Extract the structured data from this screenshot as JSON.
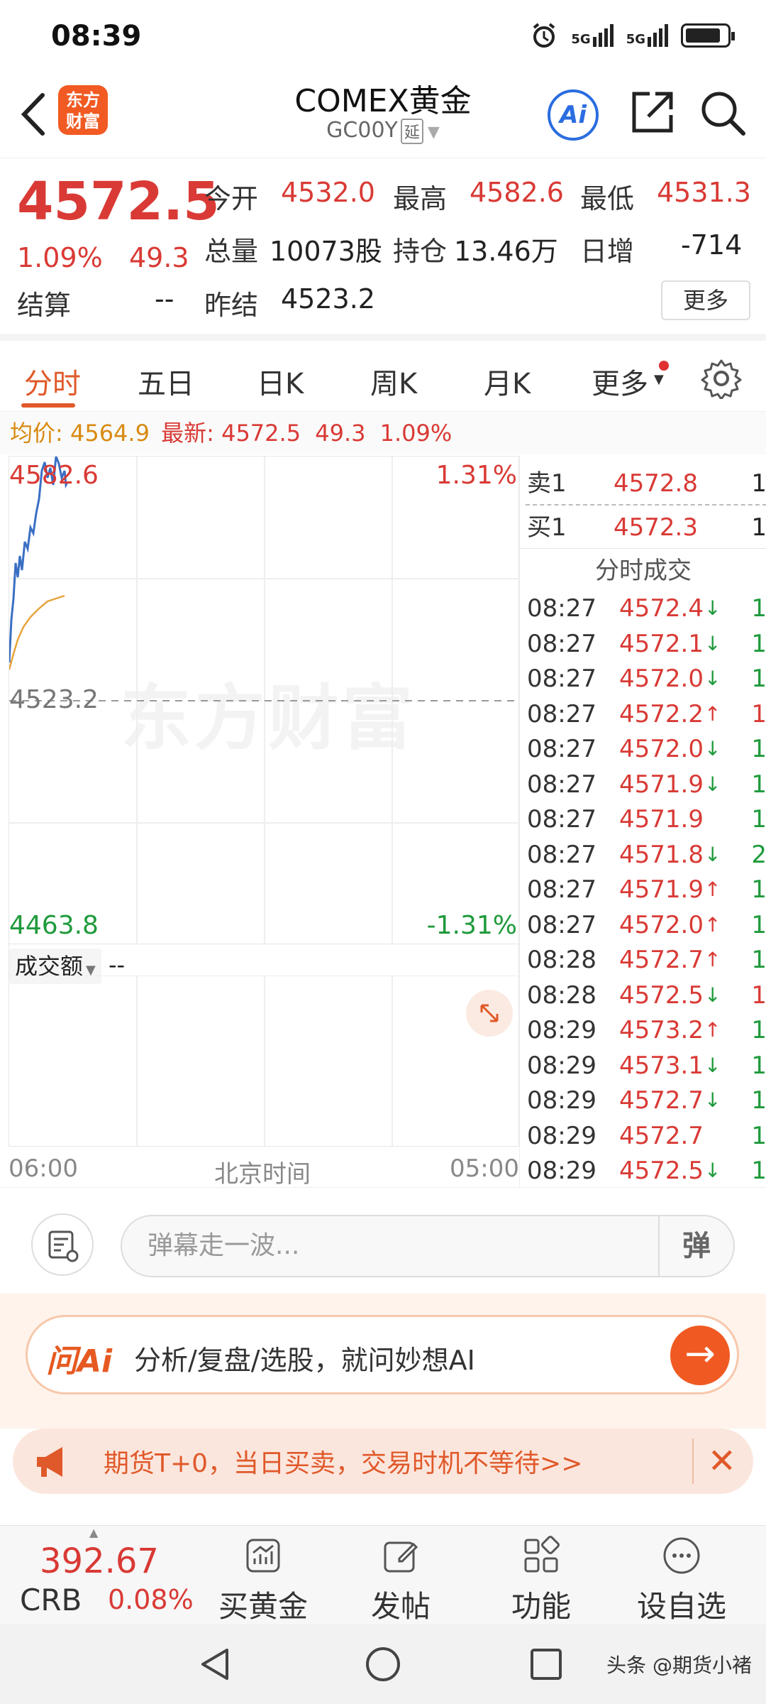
{
  "status": {
    "time": "08:39",
    "net1": "5G",
    "net2": "5G"
  },
  "header": {
    "logo_line1": "东方",
    "logo_line2": "财富",
    "title": "COMEX黄金",
    "code": "GC00Y",
    "delay_tag": "延",
    "ai_label": "Ai"
  },
  "quote": {
    "price": "4572.5",
    "change_pct": "1.09%",
    "change": "49.3",
    "open_label": "今开",
    "open": "4532.0",
    "high_label": "最高",
    "high": "4582.6",
    "low_label": "最低",
    "low": "4531.3",
    "volume_label": "总量",
    "volume": "10073股",
    "position_label": "持仓",
    "position": "13.46万",
    "daily_inc_label": "日增",
    "daily_inc": "-714",
    "settle_label": "结算",
    "settle": "--",
    "prev_settle_label": "昨结",
    "prev_settle": "4523.2",
    "more_button": "更多"
  },
  "tabs": [
    "分时",
    "五日",
    "日K",
    "周K",
    "月K",
    "更多"
  ],
  "infobar": {
    "avg_label": "均价:",
    "avg": "4564.9",
    "last_label": "最新:",
    "last": "4572.5",
    "chg": "49.3",
    "pct": "1.09%"
  },
  "chart": {
    "top_price": "4582.6",
    "top_pct": "1.31%",
    "mid_price": "4523.2",
    "bottom_price": "4463.8",
    "bottom_pct": "-1.31%",
    "watermark": "东方财富",
    "volume_selector": "成交额",
    "volume_value": "--",
    "time_start": "06:00",
    "time_zone": "北京时间",
    "time_end": "05:00"
  },
  "book": {
    "ask_label": "卖1",
    "ask_price": "4572.8",
    "ask_vol": "1",
    "bid_label": "买1",
    "bid_price": "4572.3",
    "bid_vol": "1",
    "trades_title": "分时成交",
    "trades": [
      {
        "time": "08:27",
        "price": "4572.4",
        "dir": "↓",
        "vol": "1",
        "color": "green"
      },
      {
        "time": "08:27",
        "price": "4572.1",
        "dir": "↓",
        "vol": "1",
        "color": "green"
      },
      {
        "time": "08:27",
        "price": "4572.0",
        "dir": "↓",
        "vol": "1",
        "color": "green"
      },
      {
        "time": "08:27",
        "price": "4572.2",
        "dir": "↑",
        "vol": "1",
        "color": "red"
      },
      {
        "time": "08:27",
        "price": "4572.0",
        "dir": "↓",
        "vol": "1",
        "color": "green"
      },
      {
        "time": "08:27",
        "price": "4571.9",
        "dir": "↓",
        "vol": "1",
        "color": "green"
      },
      {
        "time": "08:27",
        "price": "4571.9",
        "dir": "",
        "vol": "1",
        "color": "green"
      },
      {
        "time": "08:27",
        "price": "4571.8",
        "dir": "↓",
        "vol": "2",
        "color": "green"
      },
      {
        "time": "08:27",
        "price": "4571.9",
        "dir": "↑",
        "vol": "1",
        "color": "green"
      },
      {
        "time": "08:27",
        "price": "4572.0",
        "dir": "↑",
        "vol": "1",
        "color": "green"
      },
      {
        "time": "08:28",
        "price": "4572.7",
        "dir": "↑",
        "vol": "1",
        "color": "green"
      },
      {
        "time": "08:28",
        "price": "4572.5",
        "dir": "↓",
        "vol": "1",
        "color": "red"
      },
      {
        "time": "08:29",
        "price": "4573.2",
        "dir": "↑",
        "vol": "1",
        "color": "green"
      },
      {
        "time": "08:29",
        "price": "4573.1",
        "dir": "↓",
        "vol": "1",
        "color": "green"
      },
      {
        "time": "08:29",
        "price": "4572.7",
        "dir": "↓",
        "vol": "1",
        "color": "green"
      },
      {
        "time": "08:29",
        "price": "4572.7",
        "dir": "",
        "vol": "1",
        "color": "green"
      },
      {
        "time": "08:29",
        "price": "4572.5",
        "dir": "↓",
        "vol": "1",
        "color": "green"
      }
    ]
  },
  "danmu": {
    "placeholder": "弹幕走一波...",
    "send": "弹"
  },
  "ai_banner": {
    "logo": "问Ai",
    "text": "分析/复盘/选股，就问妙想AI"
  },
  "promo": {
    "text": "期货T+0，当日买卖，交易时机不等待>>"
  },
  "bottom_nav": {
    "index_value": "392.67",
    "index_name": "CRB",
    "index_pct": "0.08%",
    "items": [
      "买黄金",
      "发帖",
      "功能",
      "设自选"
    ]
  },
  "credit": "头条 @期货小褚",
  "colors": {
    "up": "#d93a35",
    "down": "#1f9a3b",
    "accent": "#e0592a",
    "avg_line": "#e8a33a",
    "price_line": "#3a6fc4"
  }
}
